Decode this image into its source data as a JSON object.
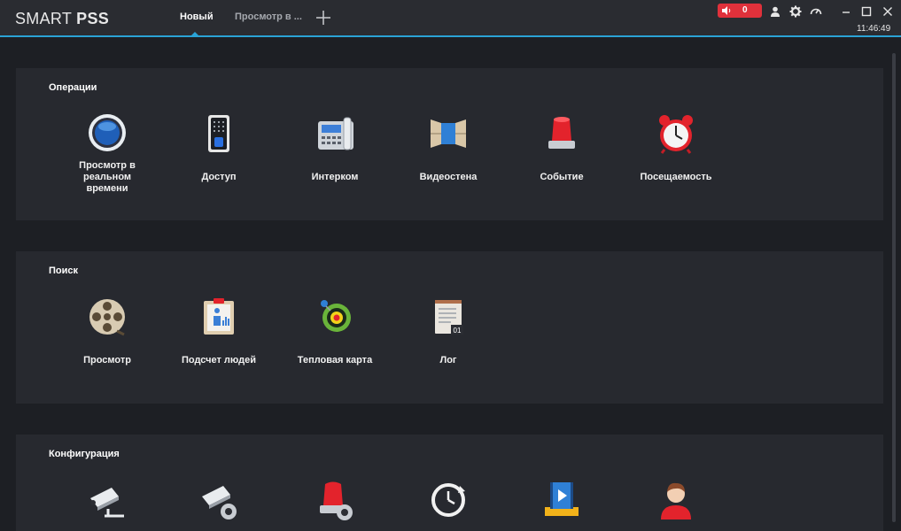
{
  "app": {
    "logo_light": "SMART ",
    "logo_bold": "PSS"
  },
  "tabs": [
    {
      "label": "Новый",
      "active": true
    },
    {
      "label": "Просмотр в ...",
      "active": false
    }
  ],
  "header": {
    "alarm_count": "0",
    "time": "11:46:49",
    "accent": "#2aa3d6",
    "alarm_color": "#e0313b"
  },
  "sections": {
    "operations": {
      "title": "Операции",
      "items": [
        {
          "label": "Просмотр в реальном времени",
          "icon": "live-view-icon"
        },
        {
          "label": "Доступ",
          "icon": "access-control-icon"
        },
        {
          "label": "Интерком",
          "icon": "intercom-icon"
        },
        {
          "label": "Видеостена",
          "icon": "video-wall-icon"
        },
        {
          "label": "Событие",
          "icon": "event-alarm-icon"
        },
        {
          "label": "Посещаемость",
          "icon": "alarm-clock-icon"
        }
      ]
    },
    "search": {
      "title": "Поиск",
      "items": [
        {
          "label": "Просмотр",
          "icon": "playback-reel-icon"
        },
        {
          "label": "Подсчет людей",
          "icon": "people-counting-icon"
        },
        {
          "label": "Тепловая карта",
          "icon": "heat-map-icon"
        },
        {
          "label": "Лог",
          "icon": "log-icon"
        }
      ]
    },
    "config": {
      "title": "Конфигурация",
      "items": [
        {
          "label": "",
          "icon": "device-camera-icon"
        },
        {
          "label": "",
          "icon": "device-config-icon"
        },
        {
          "label": "",
          "icon": "event-config-icon"
        },
        {
          "label": "",
          "icon": "sync-clock-icon"
        },
        {
          "label": "",
          "icon": "video-storage-icon"
        },
        {
          "label": "",
          "icon": "user-icon"
        }
      ]
    }
  }
}
